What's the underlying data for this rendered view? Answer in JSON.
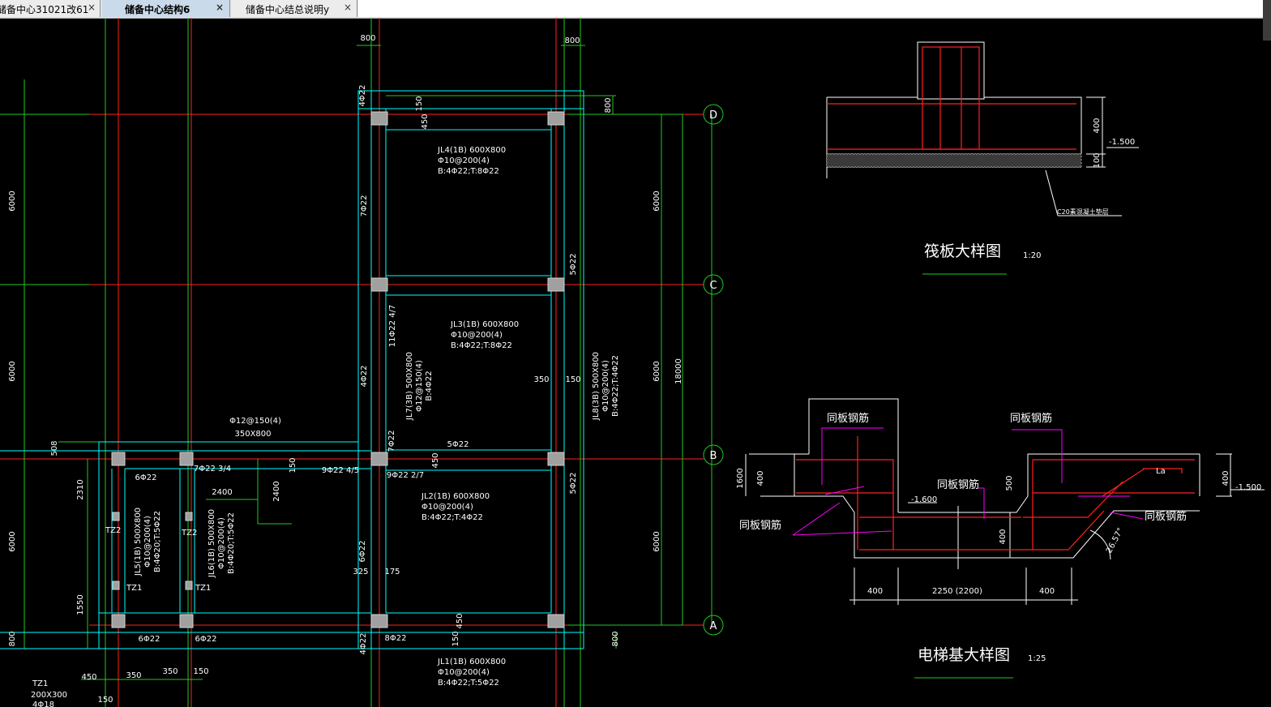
{
  "tabs": [
    {
      "label": "储备中心31021改61",
      "close": "×"
    },
    {
      "label": "储备中心结构6",
      "close": "×"
    },
    {
      "label": "储备中心结总说明y",
      "close": "×"
    }
  ],
  "axes": {
    "D": "D",
    "C": "C",
    "B": "B",
    "A": "A"
  },
  "dims": {
    "d6000": "6000",
    "d18000": "18000",
    "d800": "800",
    "d2310": "2310",
    "d1550": "1550",
    "d508": "508",
    "d2400": "2400",
    "d450": "450",
    "d350": "350",
    "d150": "150",
    "d325": "325",
    "d175": "175"
  },
  "beams": {
    "jl4": [
      "JL4(1B) 600X800",
      "Φ10@200(4)",
      "B:4Φ22;T:8Φ22"
    ],
    "jl3": [
      "JL3(1B) 600X800",
      "Φ10@200(4)",
      "B:4Φ22;T:8Φ22"
    ],
    "jl2": [
      "JL2(1B) 600X800",
      "Φ10@200(4)",
      "B:4Φ22;T:4Φ22"
    ],
    "jl1": [
      "JL1(1B) 600X800",
      "Φ10@200(4)",
      "B:4Φ22;T:5Φ22"
    ],
    "jl7": [
      "JL7(3B) 500X800",
      "Φ12@150(4)",
      "B:4Φ22"
    ],
    "jl8": [
      "JL8(3B) 500X800",
      "Φ10@200(4)",
      "B:4Φ22;T:4Φ22"
    ],
    "jl5": [
      "JL5(1B) 500X800",
      "Φ10@200(4)",
      "B:4Φ20;T:5Φ22"
    ],
    "jl6": [
      "JL6(1B) 500X800",
      "Φ10@200(4)",
      "B:4Φ20;T:5Φ22"
    ],
    "rebar_slab": "Φ12@150(4)",
    "slab_size": "350X800"
  },
  "rebar": {
    "r4_22": "4Φ22",
    "r7_22": "7Φ22",
    "r5_22": "5Φ22",
    "r6_22": "6Φ22",
    "r8_22": "8Φ22",
    "r11_22": "11Φ22 4/7",
    "r7_22_34": "7Φ22 3/4",
    "r9_22_45": "9Φ22 4/5",
    "r9_22_27": "9Φ22 2/7"
  },
  "columns": {
    "tz1": "TZ1",
    "tz2": "TZ2",
    "tz1_size": "200X300",
    "tz1_rebar": "4Φ18"
  },
  "raft_detail": {
    "title": "筏板大样图",
    "scale": "1:20",
    "dim400": "400",
    "dim100": "100",
    "elev": "-1.500",
    "note": "C20素混凝土垫层"
  },
  "elevator_detail": {
    "title": "电梯基大样图",
    "scale": "1:25",
    "same_rebar": "同板钢筋",
    "dim1600": "1600",
    "dim400": "400",
    "dim500": "500",
    "dim2250": "2250 (2200)",
    "elev_left": "-1.600",
    "elev_right": "-1.500",
    "angle": "26.57°",
    "la": "La"
  },
  "colors": {
    "grid_red": "#ff2020",
    "grid_green": "#22c822",
    "beam_cyan": "#00ffff",
    "text_white": "#ffffff",
    "magenta": "#ff00ff",
    "column_gray": "#a0a0a0"
  }
}
